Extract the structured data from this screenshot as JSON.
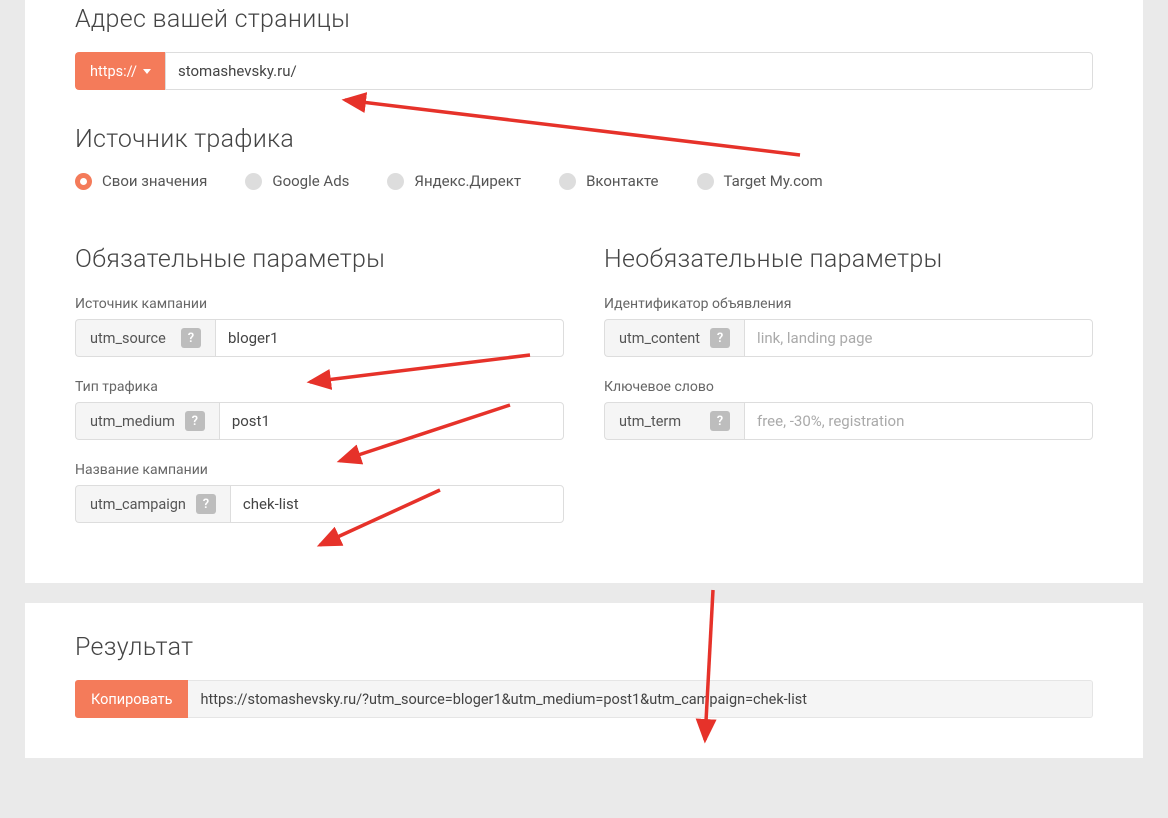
{
  "colors": {
    "accent": "#f47b5a"
  },
  "address": {
    "heading": "Адрес вашей страницы",
    "protocol_label": "https://",
    "url_value": "stomashevsky.ru/"
  },
  "traffic": {
    "heading": "Источник трафика",
    "options": [
      {
        "label": "Свои значения",
        "selected": true
      },
      {
        "label": "Google Ads",
        "selected": false
      },
      {
        "label": "Яндекс.Директ",
        "selected": false
      },
      {
        "label": "Вконтакте",
        "selected": false
      },
      {
        "label": "Target My.com",
        "selected": false
      }
    ]
  },
  "required": {
    "heading": "Обязательные параметры",
    "source": {
      "label": "Источник кампании",
      "tag": "utm_source",
      "value": "bloger1"
    },
    "medium": {
      "label": "Тип трафика",
      "tag": "utm_medium",
      "value": "post1"
    },
    "campaign": {
      "label": "Название кампании",
      "tag": "utm_campaign",
      "value": "chek-list"
    }
  },
  "optional": {
    "heading": "Необязательные параметры",
    "content": {
      "label": "Идентификатор объявления",
      "tag": "utm_content",
      "placeholder": "link, landing page"
    },
    "term": {
      "label": "Ключевое слово",
      "tag": "utm_term",
      "placeholder": "free, -30%, registration"
    }
  },
  "result": {
    "heading": "Результат",
    "copy_label": "Копировать",
    "url": "https://stomashevsky.ru/?utm_source=bloger1&utm_medium=post1&utm_campaign=chek-list"
  },
  "help_glyph": "?"
}
